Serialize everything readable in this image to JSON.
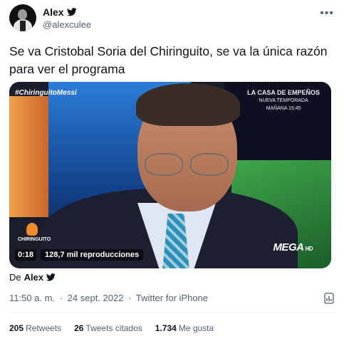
{
  "author": {
    "display_name": "Alex",
    "handle": "@alexculee",
    "verified_icon": "twitter-bird-icon"
  },
  "tweet": {
    "text": "Se va Cristobal Soria del Chiringuito, se va la única razón para ver el programa"
  },
  "video": {
    "hashtag": "#ChiringuitoMessi",
    "promo_line1": "LA CASA DE EMPEÑOS",
    "promo_line2": "NUEVA TEMPORADA",
    "promo_line3": "MAÑANA 15:45",
    "show_logo": "CHIRINGUITO",
    "channel_logo": "MEGA",
    "channel_hd": "HD",
    "duration": "0:18",
    "views": "128,7 mil reproducciones"
  },
  "attribution": {
    "prefix": "De",
    "name": "Alex"
  },
  "meta": {
    "time": "11:50 a. m.",
    "separator": "·",
    "date": "24 sept. 2022",
    "source": "Twitter for iPhone"
  },
  "stats": {
    "retweets_count": "205",
    "retweets_label": "Retweets",
    "quotes_count": "26",
    "quotes_label": "Tweets citados",
    "likes_count": "1.734",
    "likes_label": "Me gusta"
  },
  "colors": {
    "text": "#0f1419",
    "secondary": "#536471",
    "divider": "#eff3f4"
  }
}
